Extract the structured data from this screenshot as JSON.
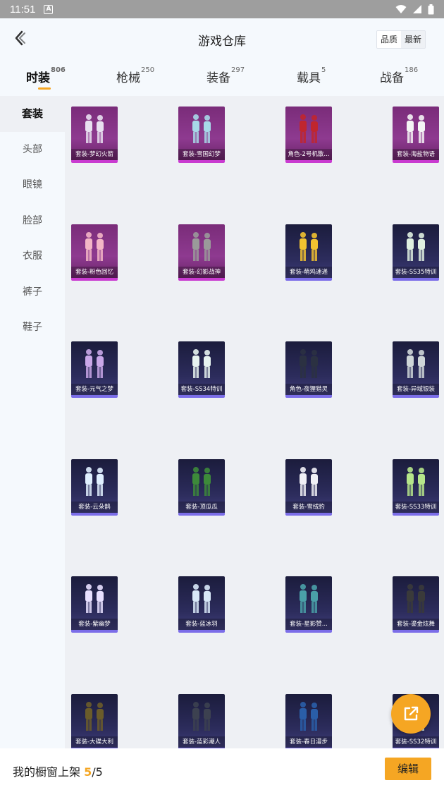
{
  "status_bar": {
    "time": "11:51",
    "app_icon": "A"
  },
  "header": {
    "title": "游戏仓库",
    "sort": {
      "quality": "品质",
      "latest": "最新"
    }
  },
  "tabs": [
    {
      "label": "时装",
      "count": "806"
    },
    {
      "label": "枪械",
      "count": "250"
    },
    {
      "label": "装备",
      "count": "297"
    },
    {
      "label": "载具",
      "count": "5"
    },
    {
      "label": "战备",
      "count": "186"
    }
  ],
  "sidebar": {
    "items": [
      "套装",
      "头部",
      "眼镜",
      "脸部",
      "衣服",
      "裤子",
      "鞋子"
    ]
  },
  "items": [
    {
      "label": "套装-梦幻火箭",
      "rarity": "purple"
    },
    {
      "label": "套装-雪国幻梦",
      "rarity": "purple"
    },
    {
      "label": "角色-2号机散...",
      "rarity": "purple"
    },
    {
      "label": "套装-海盐物语",
      "rarity": "purple"
    },
    {
      "label": "套装-粉色回忆",
      "rarity": "purple"
    },
    {
      "label": "套装-幻影战神",
      "rarity": "purple"
    },
    {
      "label": "套装-萌鸡速递",
      "rarity": "blue"
    },
    {
      "label": "套装-SS35特训",
      "rarity": "blue"
    },
    {
      "label": "套装-元气之梦",
      "rarity": "blue"
    },
    {
      "label": "套装-SS34特训",
      "rarity": "blue"
    },
    {
      "label": "角色-夜狸猎灵",
      "rarity": "blue"
    },
    {
      "label": "套装-异域银装",
      "rarity": "blue"
    },
    {
      "label": "套装-云朵鹊",
      "rarity": "blue"
    },
    {
      "label": "套装-顶瓜瓜",
      "rarity": "blue"
    },
    {
      "label": "套装-雪绒豹",
      "rarity": "blue"
    },
    {
      "label": "套装-SS33特训",
      "rarity": "blue"
    },
    {
      "label": "套装-紫幽梦",
      "rarity": "blue"
    },
    {
      "label": "套装-蓝冰羽",
      "rarity": "blue"
    },
    {
      "label": "套装-星影赞...",
      "rarity": "blue"
    },
    {
      "label": "套装-鎏金炫舞",
      "rarity": "blue"
    },
    {
      "label": "套装-大碟大利",
      "rarity": "blue"
    },
    {
      "label": "套装-蓝彩潮人",
      "rarity": "blue"
    },
    {
      "label": "套装-春日漫步",
      "rarity": "blue"
    },
    {
      "label": "套装-SS32特训",
      "rarity": "blue"
    }
  ],
  "showcase": {
    "prefix": "我的橱窗上架 ",
    "current": "5",
    "separator": "/",
    "total": "5",
    "edit_label": "编辑"
  },
  "colors": {
    "accent": "#f5a623",
    "purple_rarity": "#c93bd0",
    "blue_rarity": "#7b6de8"
  }
}
